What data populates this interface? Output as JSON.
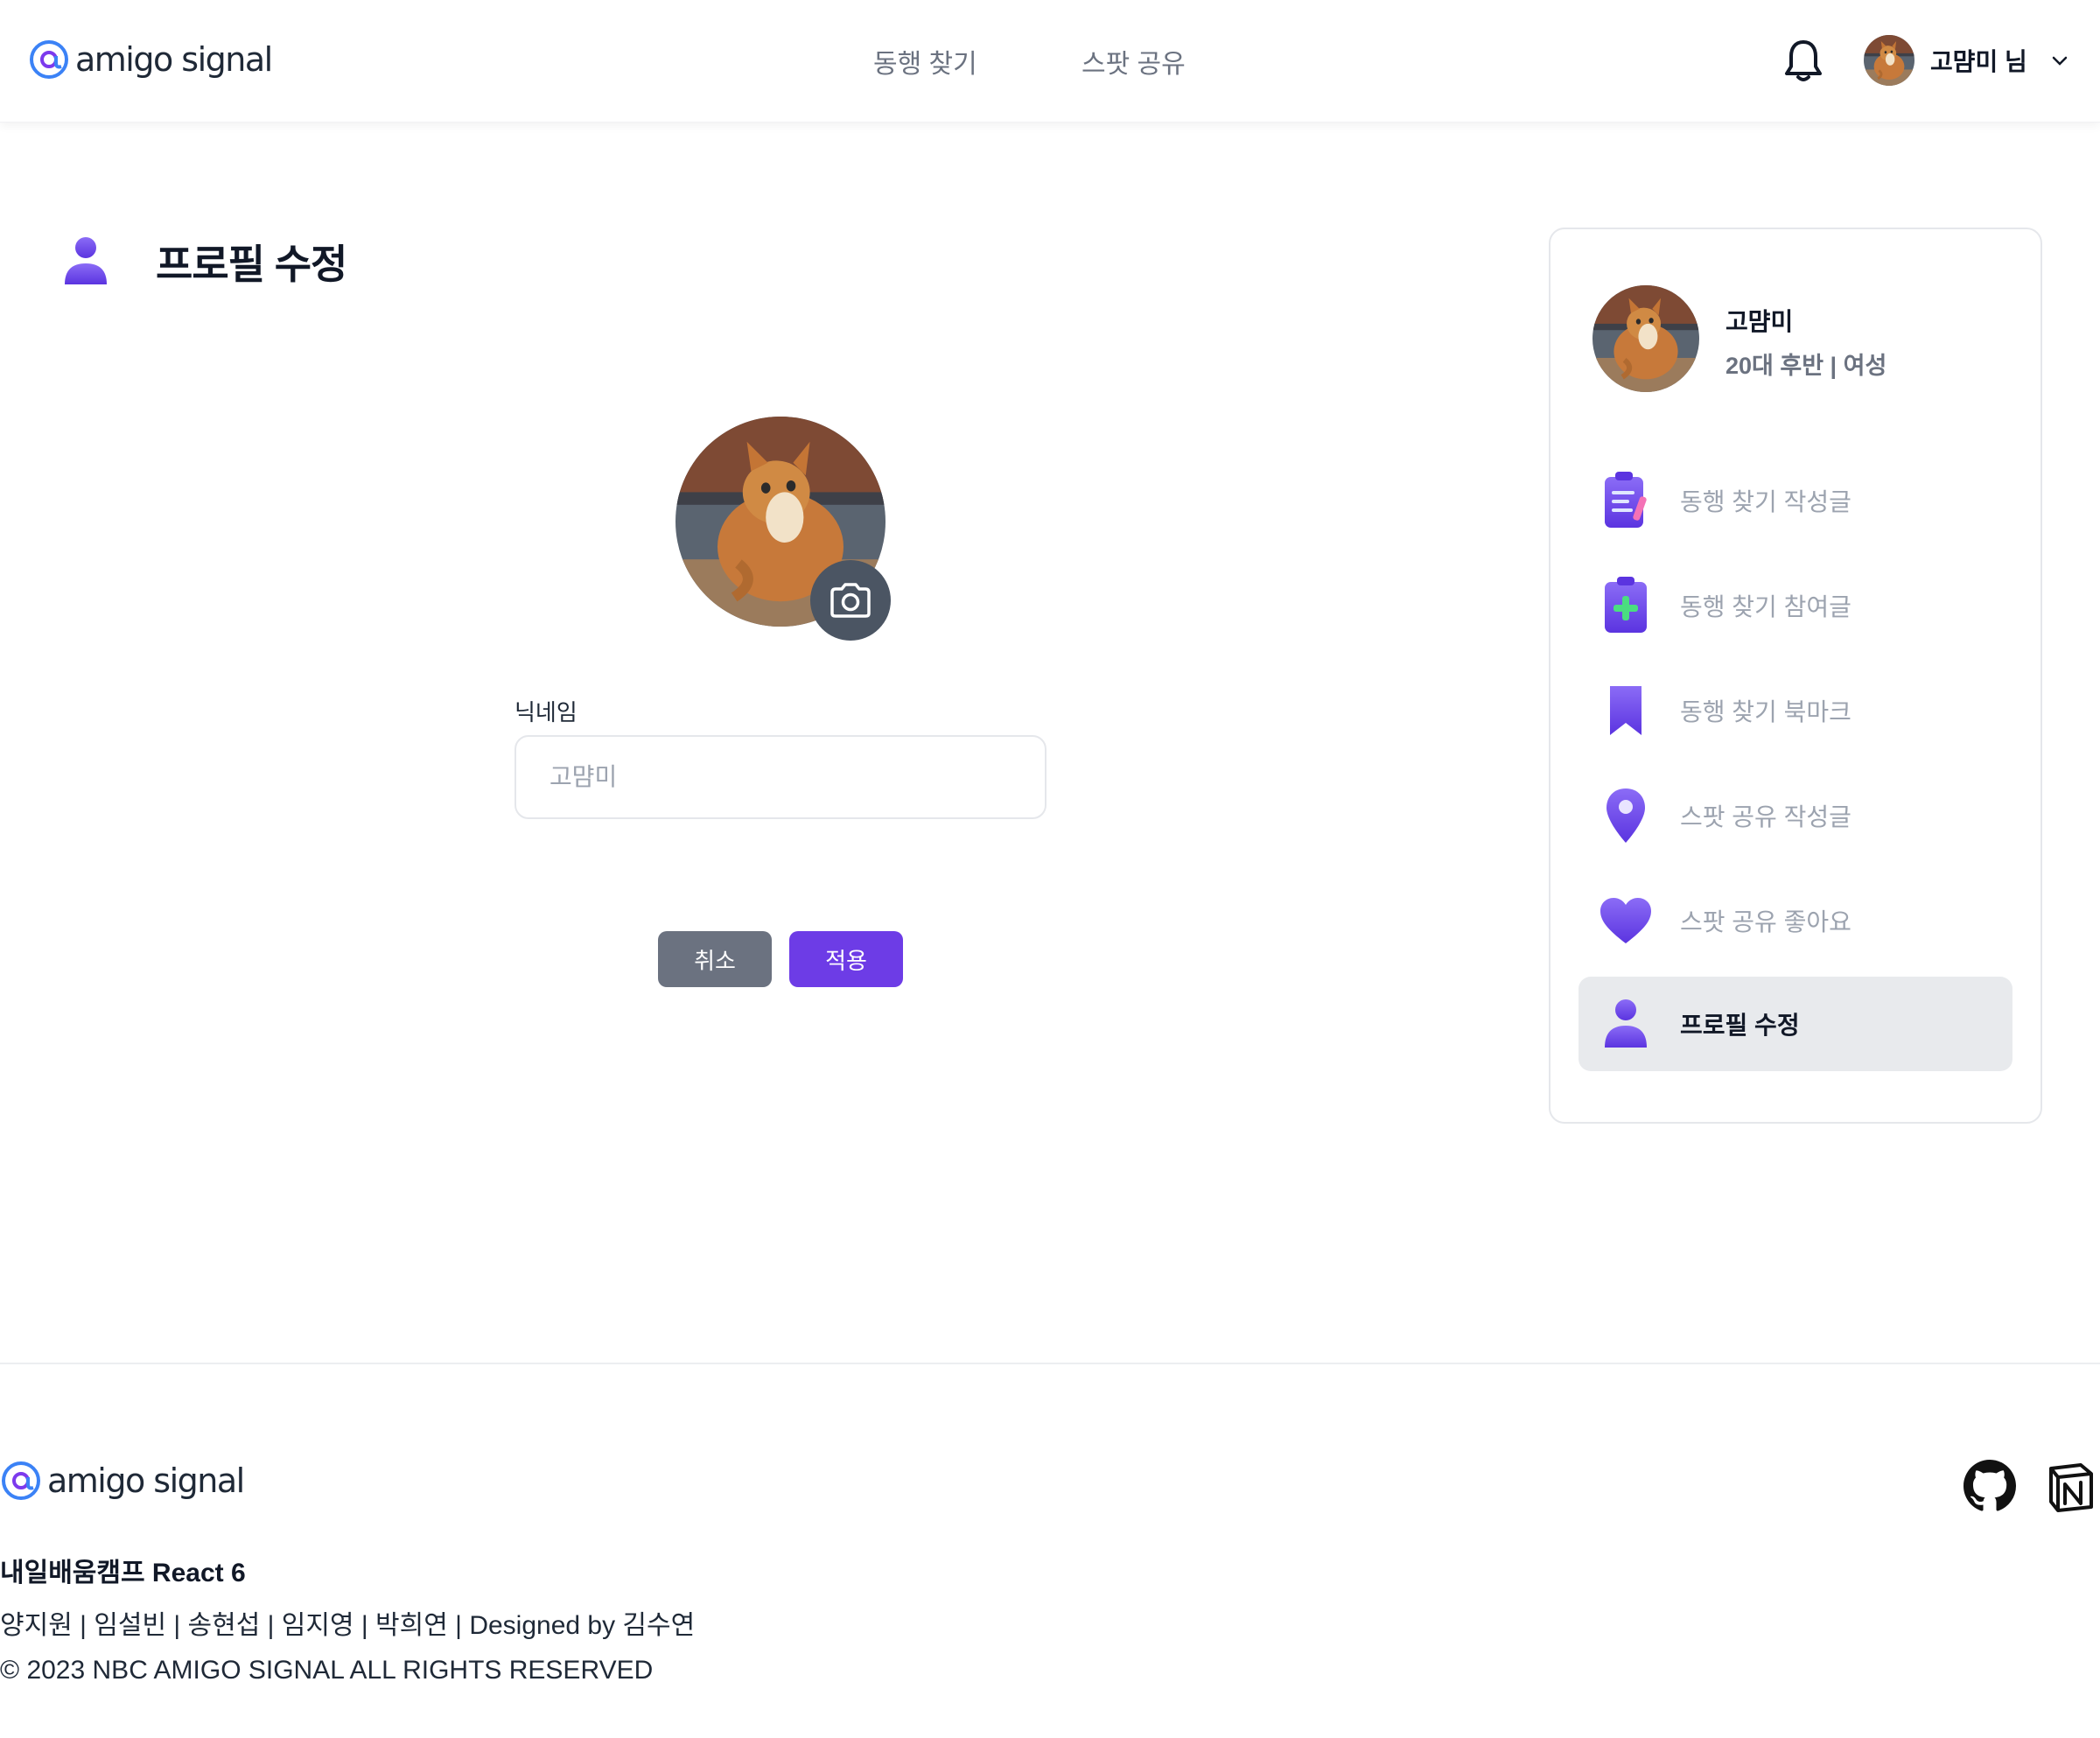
{
  "brand": {
    "logo_text": "amigo signal"
  },
  "header": {
    "nav": [
      "동행 찾기",
      "스팟 공유"
    ],
    "user_label": "고먐미 님"
  },
  "page": {
    "title": "프로필 수정"
  },
  "form": {
    "nickname_label": "닉네임",
    "nickname_placeholder": "고먐미",
    "cancel_label": "취소",
    "apply_label": "적용"
  },
  "sidebar": {
    "name": "고먐미",
    "meta": "20대 후반 | 여성",
    "items": [
      {
        "label": "동행 찾기 작성글",
        "icon": "clipboard-list-icon"
      },
      {
        "label": "동행 찾기 참여글",
        "icon": "clipboard-plus-icon"
      },
      {
        "label": "동행 찾기 북마크",
        "icon": "bookmark-icon"
      },
      {
        "label": "스팟 공유 작성글",
        "icon": "map-pin-icon"
      },
      {
        "label": "스팟 공유 좋아요",
        "icon": "heart-icon"
      },
      {
        "label": "프로필 수정",
        "icon": "user-icon",
        "active": true
      }
    ]
  },
  "footer": {
    "brand_line": "내일배움캠프 React 6",
    "team_line": "양지원 | 임설빈 | 송현섭 | 임지영 | 박희연 | Designed by 김수연",
    "copyright": "© 2023 NBC AMIGO SIGNAL ALL RIGHTS RESERVED"
  },
  "colors": {
    "accent": "#6d3ce6",
    "cancel": "#6b7280",
    "icon_purple": "#7c5cf0"
  }
}
